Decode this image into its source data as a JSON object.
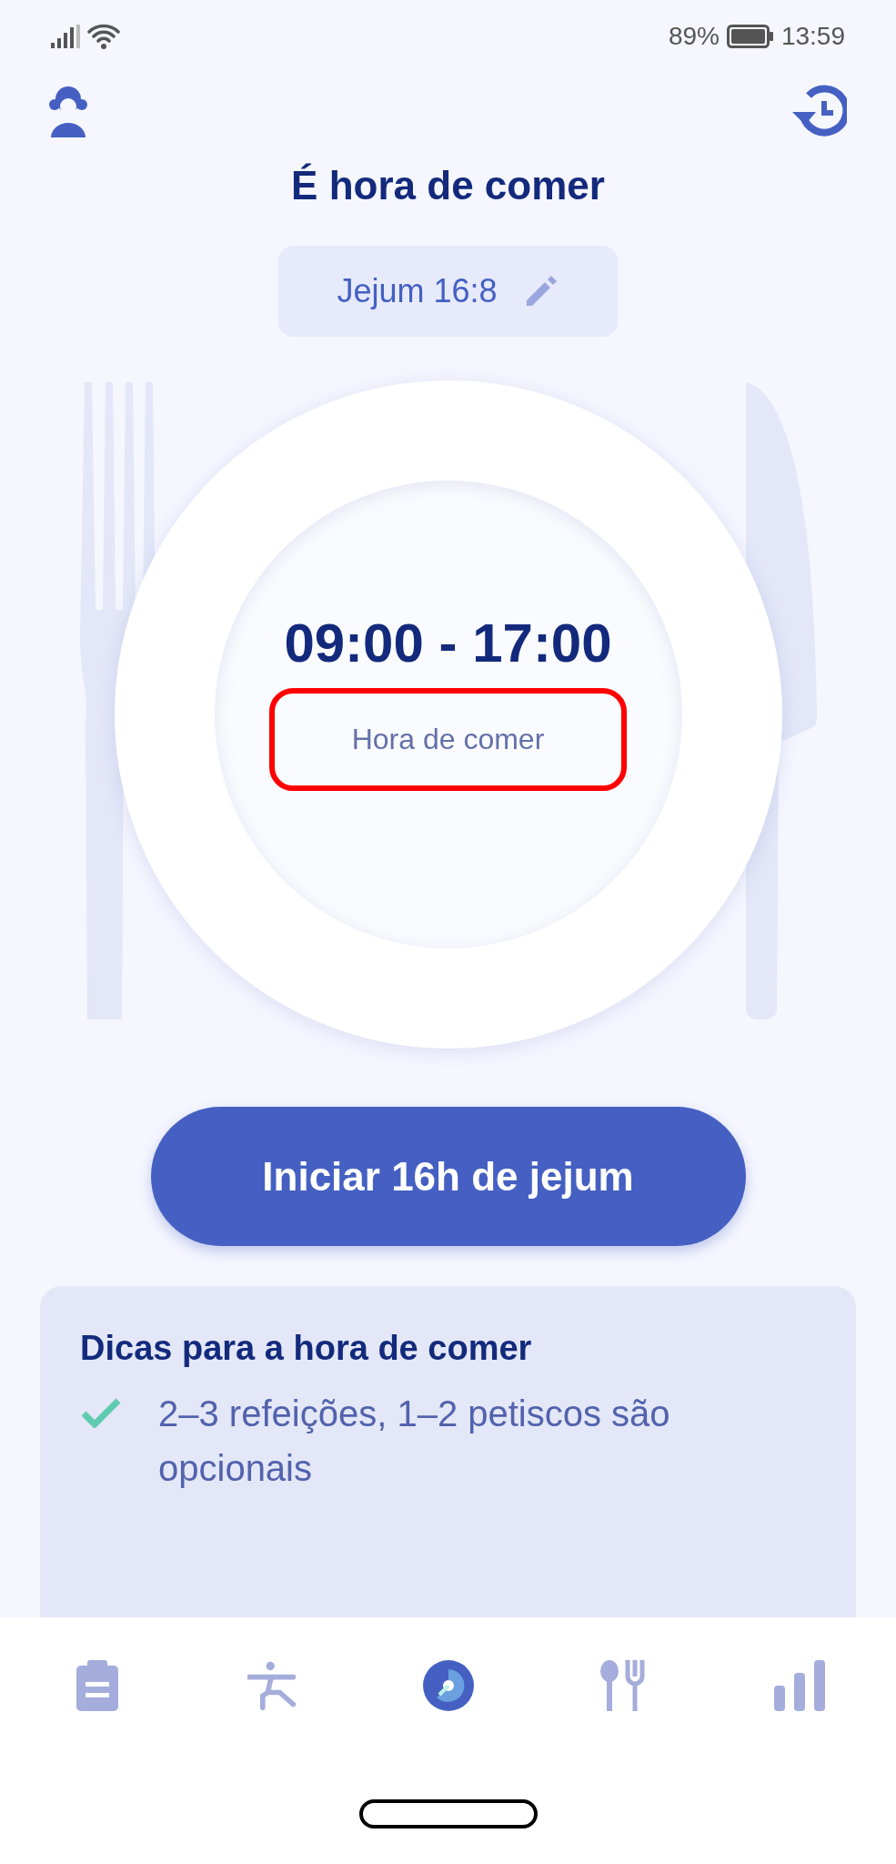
{
  "status_bar": {
    "battery": "89%",
    "time": "13:59"
  },
  "title": "É hora de comer",
  "plan_badge": {
    "label": "Jejum 16:8"
  },
  "eating_window": {
    "time_range": "09:00 - 17:00",
    "label": "Hora de comer",
    "highlighted": true
  },
  "start_button": "Iniciar 16h de jejum",
  "tips": {
    "heading": "Dicas para a hora de comer",
    "items": [
      {
        "text": "2–3 refeições, 1–2 petiscos são opcionais",
        "checked": true
      }
    ]
  },
  "bottom_nav": [
    {
      "kind": "plan",
      "selected": false
    },
    {
      "kind": "exercise",
      "selected": false
    },
    {
      "kind": "fasting",
      "selected": true
    },
    {
      "kind": "food",
      "selected": false
    },
    {
      "kind": "stats",
      "selected": false
    }
  ]
}
